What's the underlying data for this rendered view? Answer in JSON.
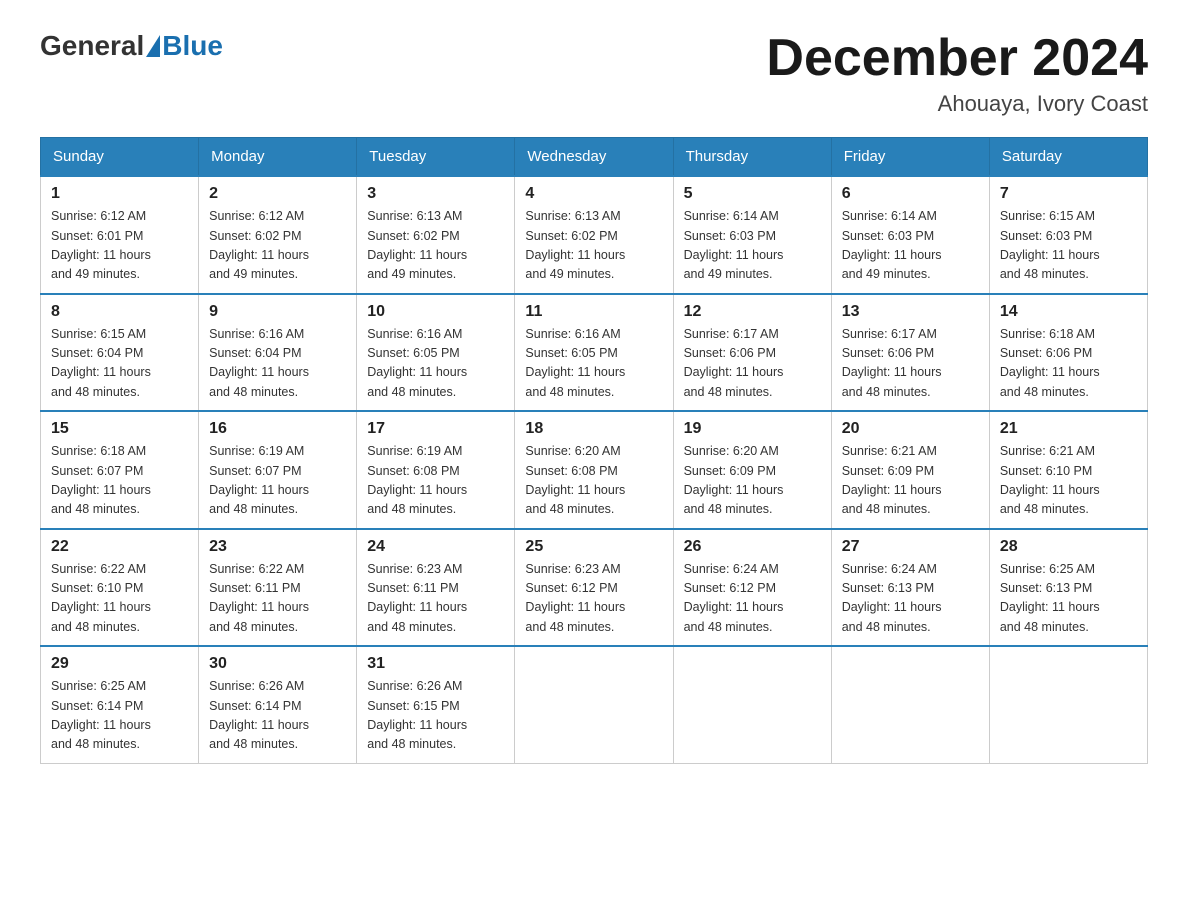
{
  "header": {
    "logo_general": "General",
    "logo_blue": "Blue",
    "main_title": "December 2024",
    "subtitle": "Ahouaya, Ivory Coast"
  },
  "weekdays": [
    "Sunday",
    "Monday",
    "Tuesday",
    "Wednesday",
    "Thursday",
    "Friday",
    "Saturday"
  ],
  "weeks": [
    [
      {
        "day": "1",
        "sunrise": "6:12 AM",
        "sunset": "6:01 PM",
        "daylight": "11 hours and 49 minutes."
      },
      {
        "day": "2",
        "sunrise": "6:12 AM",
        "sunset": "6:02 PM",
        "daylight": "11 hours and 49 minutes."
      },
      {
        "day": "3",
        "sunrise": "6:13 AM",
        "sunset": "6:02 PM",
        "daylight": "11 hours and 49 minutes."
      },
      {
        "day": "4",
        "sunrise": "6:13 AM",
        "sunset": "6:02 PM",
        "daylight": "11 hours and 49 minutes."
      },
      {
        "day": "5",
        "sunrise": "6:14 AM",
        "sunset": "6:03 PM",
        "daylight": "11 hours and 49 minutes."
      },
      {
        "day": "6",
        "sunrise": "6:14 AM",
        "sunset": "6:03 PM",
        "daylight": "11 hours and 49 minutes."
      },
      {
        "day": "7",
        "sunrise": "6:15 AM",
        "sunset": "6:03 PM",
        "daylight": "11 hours and 48 minutes."
      }
    ],
    [
      {
        "day": "8",
        "sunrise": "6:15 AM",
        "sunset": "6:04 PM",
        "daylight": "11 hours and 48 minutes."
      },
      {
        "day": "9",
        "sunrise": "6:16 AM",
        "sunset": "6:04 PM",
        "daylight": "11 hours and 48 minutes."
      },
      {
        "day": "10",
        "sunrise": "6:16 AM",
        "sunset": "6:05 PM",
        "daylight": "11 hours and 48 minutes."
      },
      {
        "day": "11",
        "sunrise": "6:16 AM",
        "sunset": "6:05 PM",
        "daylight": "11 hours and 48 minutes."
      },
      {
        "day": "12",
        "sunrise": "6:17 AM",
        "sunset": "6:06 PM",
        "daylight": "11 hours and 48 minutes."
      },
      {
        "day": "13",
        "sunrise": "6:17 AM",
        "sunset": "6:06 PM",
        "daylight": "11 hours and 48 minutes."
      },
      {
        "day": "14",
        "sunrise": "6:18 AM",
        "sunset": "6:06 PM",
        "daylight": "11 hours and 48 minutes."
      }
    ],
    [
      {
        "day": "15",
        "sunrise": "6:18 AM",
        "sunset": "6:07 PM",
        "daylight": "11 hours and 48 minutes."
      },
      {
        "day": "16",
        "sunrise": "6:19 AM",
        "sunset": "6:07 PM",
        "daylight": "11 hours and 48 minutes."
      },
      {
        "day": "17",
        "sunrise": "6:19 AM",
        "sunset": "6:08 PM",
        "daylight": "11 hours and 48 minutes."
      },
      {
        "day": "18",
        "sunrise": "6:20 AM",
        "sunset": "6:08 PM",
        "daylight": "11 hours and 48 minutes."
      },
      {
        "day": "19",
        "sunrise": "6:20 AM",
        "sunset": "6:09 PM",
        "daylight": "11 hours and 48 minutes."
      },
      {
        "day": "20",
        "sunrise": "6:21 AM",
        "sunset": "6:09 PM",
        "daylight": "11 hours and 48 minutes."
      },
      {
        "day": "21",
        "sunrise": "6:21 AM",
        "sunset": "6:10 PM",
        "daylight": "11 hours and 48 minutes."
      }
    ],
    [
      {
        "day": "22",
        "sunrise": "6:22 AM",
        "sunset": "6:10 PM",
        "daylight": "11 hours and 48 minutes."
      },
      {
        "day": "23",
        "sunrise": "6:22 AM",
        "sunset": "6:11 PM",
        "daylight": "11 hours and 48 minutes."
      },
      {
        "day": "24",
        "sunrise": "6:23 AM",
        "sunset": "6:11 PM",
        "daylight": "11 hours and 48 minutes."
      },
      {
        "day": "25",
        "sunrise": "6:23 AM",
        "sunset": "6:12 PM",
        "daylight": "11 hours and 48 minutes."
      },
      {
        "day": "26",
        "sunrise": "6:24 AM",
        "sunset": "6:12 PM",
        "daylight": "11 hours and 48 minutes."
      },
      {
        "day": "27",
        "sunrise": "6:24 AM",
        "sunset": "6:13 PM",
        "daylight": "11 hours and 48 minutes."
      },
      {
        "day": "28",
        "sunrise": "6:25 AM",
        "sunset": "6:13 PM",
        "daylight": "11 hours and 48 minutes."
      }
    ],
    [
      {
        "day": "29",
        "sunrise": "6:25 AM",
        "sunset": "6:14 PM",
        "daylight": "11 hours and 48 minutes."
      },
      {
        "day": "30",
        "sunrise": "6:26 AM",
        "sunset": "6:14 PM",
        "daylight": "11 hours and 48 minutes."
      },
      {
        "day": "31",
        "sunrise": "6:26 AM",
        "sunset": "6:15 PM",
        "daylight": "11 hours and 48 minutes."
      },
      null,
      null,
      null,
      null
    ]
  ],
  "labels": {
    "sunrise": "Sunrise:",
    "sunset": "Sunset:",
    "daylight": "Daylight:"
  }
}
